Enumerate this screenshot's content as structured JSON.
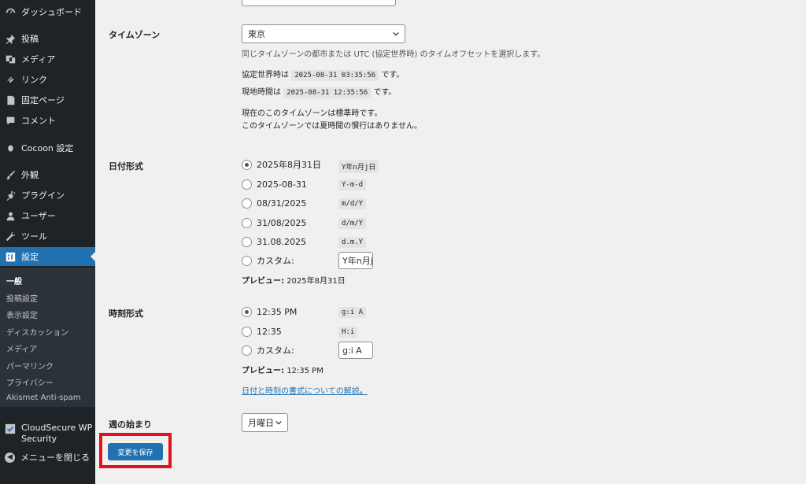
{
  "sidebar": {
    "items": [
      {
        "label": "ダッシュボード"
      },
      {
        "label": "投稿"
      },
      {
        "label": "メディア"
      },
      {
        "label": "リンク"
      },
      {
        "label": "固定ページ"
      },
      {
        "label": "コメント"
      },
      {
        "label": "Cocoon 設定"
      },
      {
        "label": "外観"
      },
      {
        "label": "プラグイン"
      },
      {
        "label": "ユーザー"
      },
      {
        "label": "ツール"
      },
      {
        "label": "設定"
      }
    ],
    "submenu": [
      "一般",
      "投稿設定",
      "表示設定",
      "ディスカッション",
      "メディア",
      "パーマリンク",
      "プライバシー",
      "Akismet Anti-spam"
    ],
    "cloudsecure": "CloudSecure WP Security",
    "collapse": "メニューを閉じる"
  },
  "settings": {
    "timezone": {
      "label": "タイムゾーン",
      "value": "東京",
      "description": "同じタイムゾーンの都市または UTC (協定世界時) のタイムオフセットを選択します。",
      "utc_prefix": "協定世界時は",
      "utc_time": "2025-08-31 03:35:56",
      "utc_suffix": "です。",
      "local_prefix": "現地時間は",
      "local_time": "2025-08-31 12:35:56",
      "local_suffix": "です。",
      "note1": "現在のこのタイムゾーンは標準時です。",
      "note2": "このタイムゾーンでは夏時間の慣行はありません。"
    },
    "date_format": {
      "label": "日付形式",
      "options": [
        {
          "label": "2025年8月31日",
          "code": "Y年n月j日"
        },
        {
          "label": "2025-08-31",
          "code": "Y-m-d"
        },
        {
          "label": "08/31/2025",
          "code": "m/d/Y"
        },
        {
          "label": "31/08/2025",
          "code": "d/m/Y"
        },
        {
          "label": "31.08.2025",
          "code": "d.m.Y"
        }
      ],
      "custom_label": "カスタム:",
      "custom_value": "Y年n月j日",
      "preview_label": "プレビュー:",
      "preview_value": "2025年8月31日"
    },
    "time_format": {
      "label": "時刻形式",
      "options": [
        {
          "label": "12:35 PM",
          "code": "g:i A"
        },
        {
          "label": "12:35",
          "code": "H:i"
        }
      ],
      "custom_label": "カスタム:",
      "custom_value": "g:i A",
      "preview_label": "プレビュー:",
      "preview_value": "12:35 PM",
      "doc_link": "日付と時刻の書式についての解説",
      "doc_link_suffix": "。"
    },
    "week_start": {
      "label": "週の始まり",
      "value": "月曜日"
    },
    "save_label": "変更を保存"
  },
  "colors": {
    "sidebar_bg": "#1d2327",
    "accent": "#2271b1",
    "highlight": "#e3111d"
  }
}
